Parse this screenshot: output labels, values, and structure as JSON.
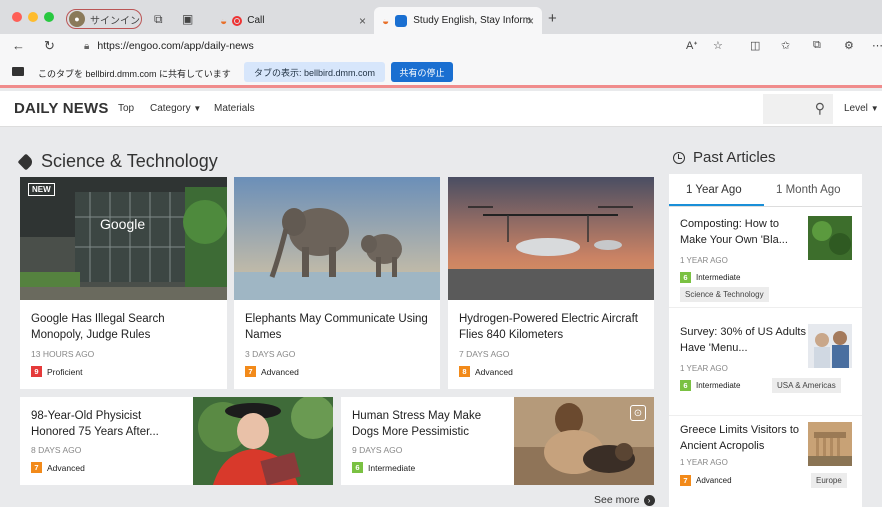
{
  "browser": {
    "signin_label": "サインイン",
    "tabs": [
      {
        "title": "Call"
      },
      {
        "title": "Study English, Stay Inform"
      }
    ],
    "url": "https://engoo.com/app/daily-news"
  },
  "sharing_bar": {
    "message": "このタブを bellbird.dmm.com に共有しています",
    "show_tab_label": "タブの表示: bellbird.dmm.com",
    "stop_label": "共有の停止"
  },
  "site_nav": {
    "logo": "DAILY NEWS",
    "items": [
      "Top",
      "Category",
      "Materials"
    ],
    "level_label": "Level"
  },
  "section": {
    "title": "Science & Technology"
  },
  "articles": [
    {
      "title": "Google Has Illegal Search Monopoly, Judge Rules",
      "date": "13 HOURS AGO",
      "level_num": "9",
      "level": "Proficient",
      "badge": "NEW",
      "img_text": "Google"
    },
    {
      "title": "Elephants May Communicate Using Names",
      "date": "3 DAYS AGO",
      "level_num": "7",
      "level": "Advanced"
    },
    {
      "title": "Hydrogen-Powered Electric Aircraft Flies 840 Kilometers",
      "date": "7 DAYS AGO",
      "level_num": "8",
      "level": "Advanced"
    },
    {
      "title": "98-Year-Old Physicist Honored 75 Years After...",
      "date": "8 DAYS AGO",
      "level_num": "7",
      "level": "Advanced"
    },
    {
      "title": "Human Stress May Make Dogs More Pessimistic",
      "date": "9 DAYS AGO",
      "level_num": "6",
      "level": "Intermediate"
    }
  ],
  "see_more": "See more",
  "past": {
    "title": "Past Articles",
    "tabs": [
      "1 Year Ago",
      "1 Month Ago"
    ],
    "items": [
      {
        "title": "Composting: How to Make Your Own 'Bla...",
        "date": "1 YEAR AGO",
        "level_num": "6",
        "level": "Intermediate",
        "category": "Science & Technology"
      },
      {
        "title": "Survey: 30% of US Adults Have 'Menu...",
        "date": "1 YEAR AGO",
        "level_num": "6",
        "level": "Intermediate",
        "category": "USA & Americas"
      },
      {
        "title": "Greece Limits Visitors to Ancient Acropolis",
        "date": "1 YEAR AGO",
        "level_num": "7",
        "level": "Advanced",
        "category": "Europe"
      }
    ]
  }
}
